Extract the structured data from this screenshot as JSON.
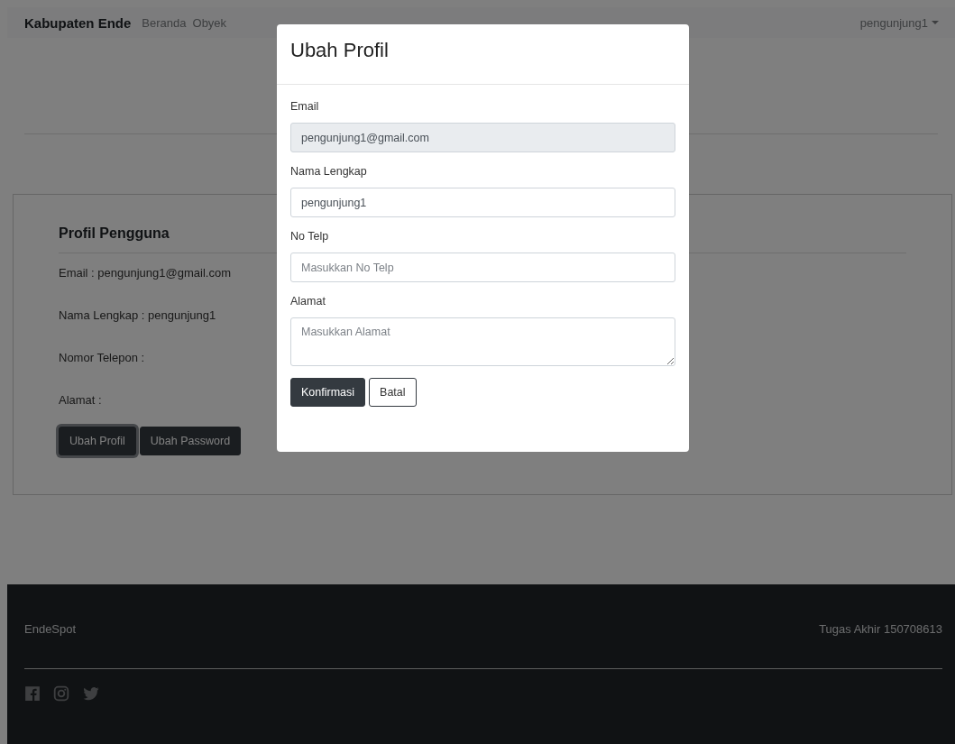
{
  "navbar": {
    "brand": "Kabupaten Ende",
    "links": [
      "Beranda",
      "Obyek"
    ],
    "user": "pengunjung1"
  },
  "profile": {
    "title": "Profil Pengguna",
    "fields": [
      "Email : pengunjung1@gmail.com",
      "Nama Lengkap : pengunjung1",
      "Nomor Telepon :",
      "Alamat :"
    ],
    "buttons": [
      "Ubah Profil",
      "Ubah Password"
    ]
  },
  "footer": {
    "brand": "EndeSpot",
    "credit": "Tugas Akhir 150708613"
  },
  "modal": {
    "title": "Ubah Profil",
    "fields": [
      {
        "label": "Email",
        "kind": "input",
        "value": "pengunjung1@gmail.com",
        "disabled": true
      },
      {
        "label": "Nama Lengkap",
        "kind": "input",
        "value": "pengunjung1",
        "disabled": false
      },
      {
        "label": "No Telp",
        "kind": "input",
        "placeholder": "Masukkan No Telp",
        "disabled": false
      },
      {
        "label": "Alamat",
        "kind": "textarea",
        "placeholder": "Masukkan Alamat",
        "disabled": false
      }
    ],
    "confirm": "Konfirmasi",
    "cancel": "Batal"
  }
}
